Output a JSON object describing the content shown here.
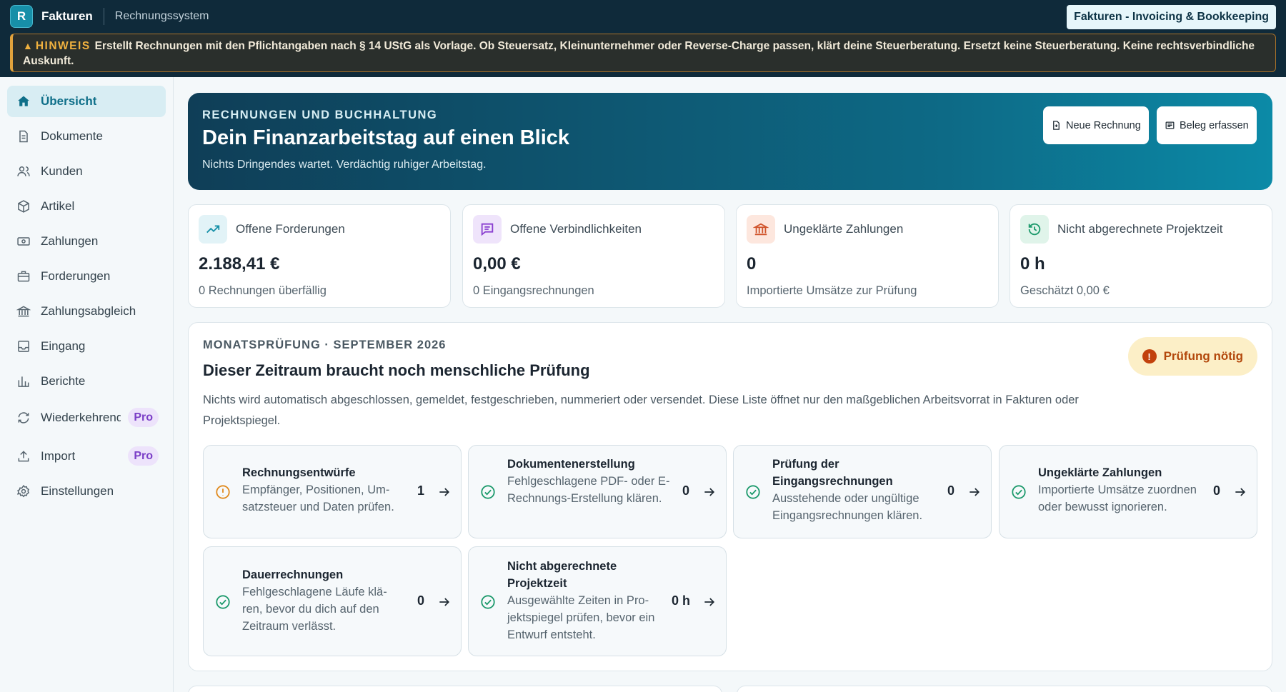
{
  "topbar": {
    "logo_letter": "R",
    "app_name": "Fakturen",
    "app_subtitle": "Rechnungssystem",
    "brand": "Fakturen - Invoicing & Bookkeeping"
  },
  "notice": {
    "tag": "HINWEIS",
    "text": "Erstellt Rechnungen mit den Pflichtangaben nach § 14 UStG als Vorlage. Ob Steuersatz, Kleinunternehmer oder Reverse-Charge passen, klärt deine Steuerberatung. Ersetzt keine Steuerberatung. Keine rechtsverbindliche Auskunft."
  },
  "sidebar": {
    "items": [
      {
        "label": "Übersicht",
        "icon": "home-icon",
        "active": true
      },
      {
        "label": "Dokumente",
        "icon": "document-icon"
      },
      {
        "label": "Kunden",
        "icon": "users-icon"
      },
      {
        "label": "Artikel",
        "icon": "package-icon"
      },
      {
        "label": "Zahlungen",
        "icon": "banknote-icon"
      },
      {
        "label": "Forderungen",
        "icon": "briefcase-icon"
      },
      {
        "label": "Zahlungsabgleich",
        "icon": "bank-icon"
      },
      {
        "label": "Eingang",
        "icon": "inbox-icon"
      },
      {
        "label": "Berichte",
        "icon": "bar-chart-icon"
      },
      {
        "label": "Wiederkehrende Rechnungen",
        "icon": "repeat-icon",
        "badge": "Pro"
      },
      {
        "label": "Import",
        "icon": "upload-icon",
        "badge": "Pro"
      },
      {
        "label": "Einstellungen",
        "icon": "gear-icon"
      }
    ]
  },
  "hero": {
    "eyebrow": "RECHNUNGEN UND BUCHHALTUNG",
    "title": "Dein Finanzarbeitstag auf einen Blick",
    "subtitle": "Nichts Dringendes wartet. Verdächtig ruhiger Arbeitstag.",
    "new_invoice": "Neue Rechnung",
    "add_receipt": "Beleg erfassen"
  },
  "kpis": [
    {
      "label": "Offene Forderungen",
      "value": "2.188,41 €",
      "note": "0 Rechnungen überfällig",
      "icon": "trending-up-icon",
      "color": "#1690a8",
      "bg": "#e2f3f7"
    },
    {
      "label": "Offene Verbindlichkeiten",
      "value": "0,00 €",
      "note": "0 Eingangsrechnungen",
      "icon": "message-icon",
      "color": "#8a3fd0",
      "bg": "#efe4fb"
    },
    {
      "label": "Ungeklärte Zahlungen",
      "value": "0",
      "note": "Importierte Umsätze zur Prüfung",
      "icon": "bank-icon",
      "color": "#d0532a",
      "bg": "#fde7de"
    },
    {
      "label": "Nicht abgerechnete Projektzeit",
      "value": "0 h",
      "note": "Geschätzt 0,00 €",
      "icon": "history-icon",
      "color": "#1d9a6c",
      "bg": "#e0f4ea"
    }
  ],
  "month": {
    "eyebrow": "MONATSPRÜFUNG · SEPTEMBER 2026",
    "title": "Dieser Zeitraum braucht noch menschliche Prüfung",
    "description": "Nichts wird automatisch abgeschlossen, gemeldet, festgeschrieben, nummeriert oder versendet. Diese Liste öffnet nur den maßgeblichen Arbeitsvorrat in Fakturen oder Projektspiegel.",
    "status": "Prüfung nötig"
  },
  "tasks": [
    {
      "title": "Rechnungsentwürfe",
      "body": "Empfänger, Positionen, Um-satzsteuer und Daten prüfen.",
      "count": "1",
      "state": "warning"
    },
    {
      "title": "Dokumentenerstellung",
      "body": "Fehlgeschlagene PDF- oder E-Rechnungs-Erstellung klären.",
      "count": "0",
      "state": "ok"
    },
    {
      "title": "Prüfung der Eingangsrechnungen",
      "body": "Ausstehende oder ungültige Eingangsrechnungen klären.",
      "count": "0",
      "state": "ok"
    },
    {
      "title": "Ungeklärte Zahlungen",
      "body": "Importierte Umsätze zuordnen oder bewusst ignorieren.",
      "count": "0",
      "state": "ok"
    },
    {
      "title": "Dauerrechnungen",
      "body": "Fehlgeschlagene Läufe klä-ren, bevor du dich auf den Zeitraum verlässt.",
      "count": "0",
      "state": "ok"
    },
    {
      "title": "Nicht abgerechnete Projektzeit",
      "body": "Ausgewählte Zeiten in Pro-jektspiegel prüfen, bevor ein Entwurf entsteht.",
      "count": "0 h",
      "state": "ok"
    }
  ],
  "colors": {
    "accent": "#0f6f89",
    "topbar": "#0f2a3a",
    "warning": "#e08a1e",
    "ok": "#1d9a6c"
  }
}
